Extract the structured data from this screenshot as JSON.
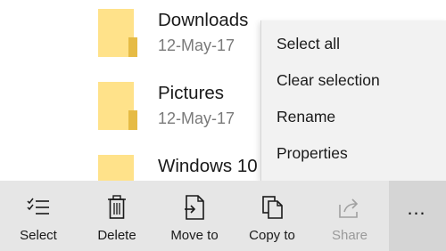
{
  "files": [
    {
      "name": "Downloads",
      "date": "12-May-17"
    },
    {
      "name": "Pictures",
      "date": "12-May-17"
    },
    {
      "name": "Windows 10",
      "date": ""
    }
  ],
  "context_menu": {
    "items": [
      "Select all",
      "Clear selection",
      "Rename",
      "Properties"
    ]
  },
  "appbar": {
    "select_label": "Select",
    "delete_label": "Delete",
    "move_label": "Move to",
    "copy_label": "Copy to",
    "share_label": "Share",
    "more_label": "…",
    "select_icon": "checklist-icon",
    "delete_icon": "trash-icon",
    "move_icon": "move-document-icon",
    "copy_icon": "copy-icon",
    "share_icon": "share-icon",
    "more_icon": "ellipsis-icon"
  },
  "colors": {
    "folder_front": "#ffe28a",
    "folder_back": "#f7d770",
    "appbar_bg": "#e6e6e6",
    "menu_bg": "#f2f2f2",
    "date_text": "#7a7a7a"
  }
}
